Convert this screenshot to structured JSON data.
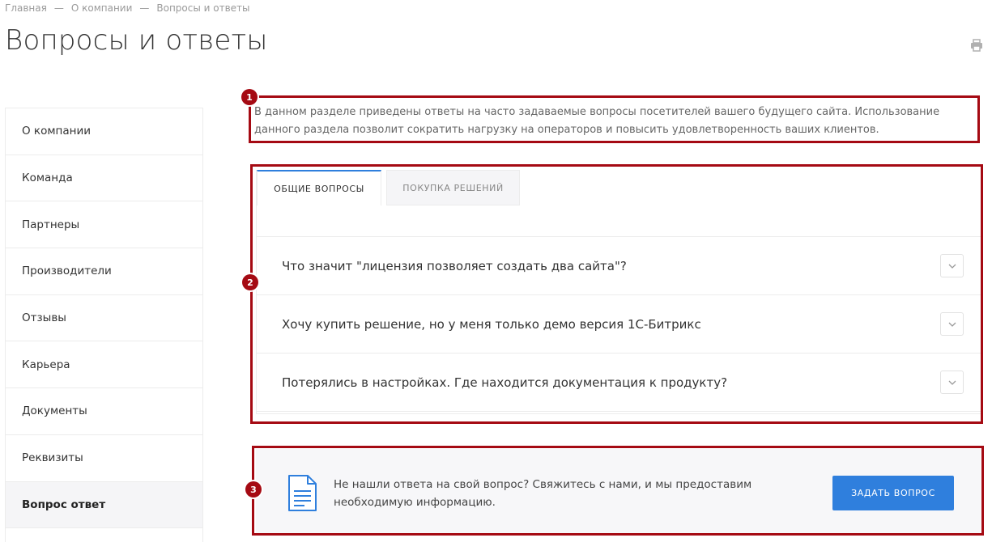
{
  "breadcrumb": {
    "items": [
      "Главная",
      "О компании",
      "Вопросы и ответы"
    ],
    "separator": "—"
  },
  "page": {
    "title": "Вопросы и ответы"
  },
  "icons": {
    "print": "print-icon",
    "chevron": "chevron-down-icon",
    "document": "document-icon"
  },
  "sidebar": {
    "items": [
      {
        "label": "О компании"
      },
      {
        "label": "Команда"
      },
      {
        "label": "Партнеры"
      },
      {
        "label": "Производители"
      },
      {
        "label": "Отзывы"
      },
      {
        "label": "Карьера"
      },
      {
        "label": "Документы"
      },
      {
        "label": "Реквизиты"
      },
      {
        "label": "Вопрос ответ",
        "active": true
      }
    ]
  },
  "intro": {
    "text": "В данном разделе приведены ответы на часто задаваемые вопросы посетителей вашего будущего сайта. Использование данного раздела позволит сократить нагрузку на операторов и повысить удовлетворенность ваших клиентов."
  },
  "tabs": [
    {
      "label": "Общие вопросы",
      "active": true
    },
    {
      "label": "Покупка решений",
      "active": false
    }
  ],
  "faq": [
    {
      "question": "Что значит \"лицензия позволяет создать два сайта\"?"
    },
    {
      "question": "Хочу купить решение, но у меня только демо версия 1С-Битрикс"
    },
    {
      "question": "Потерялись в настройках. Где находится документация к продукту?"
    }
  ],
  "ask": {
    "text": "Не нашли ответа на свой вопрос? Свяжитесь с нами, и мы предоставим необходимую информацию.",
    "button_label": "Задать вопрос"
  },
  "annotations": {
    "badge_1": "1",
    "badge_2": "2",
    "badge_3": "3",
    "color": "#a50a13"
  },
  "colors": {
    "accent": "#2f7fdd",
    "annotation": "#a50a13"
  }
}
